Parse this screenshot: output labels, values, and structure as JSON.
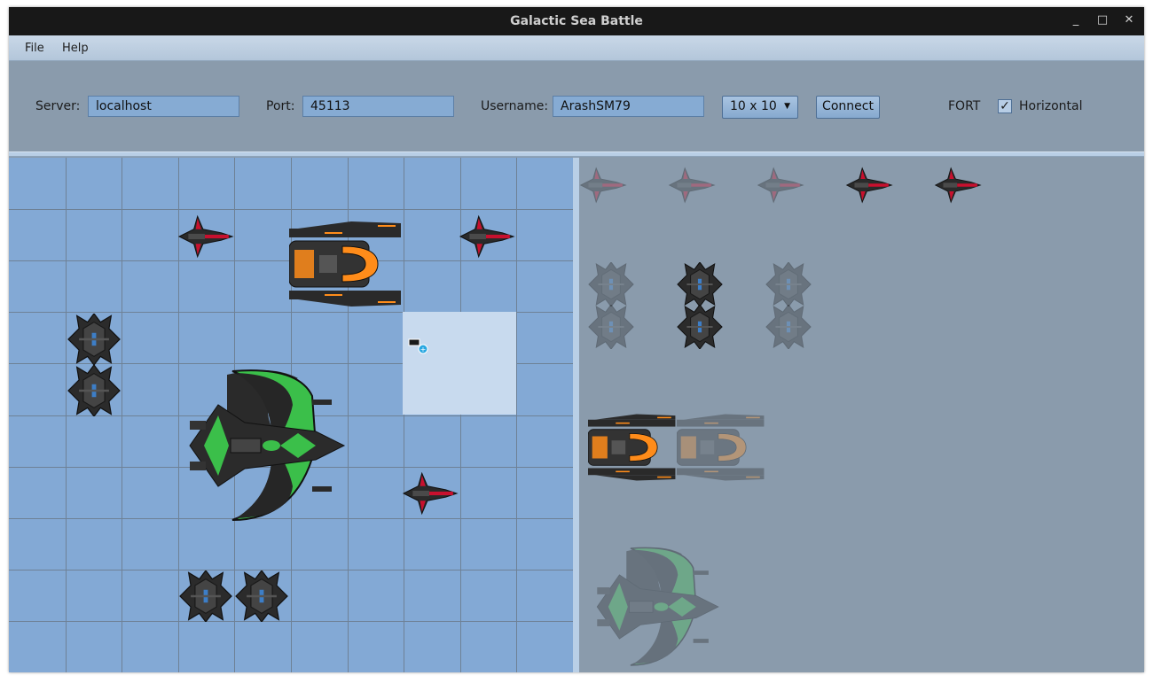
{
  "window": {
    "title": "Galactic Sea Battle",
    "minimize_glyph": "_",
    "maximize_glyph": "□",
    "close_glyph": "✕"
  },
  "menu": {
    "items": [
      {
        "label": "File"
      },
      {
        "label": "Help"
      }
    ]
  },
  "connection": {
    "server_label": "Server:",
    "server_value": "localhost",
    "port_label": "Port:",
    "port_value": "45113",
    "username_label": "Username:",
    "username_value": "ArashSM79",
    "board_size_value": "10 x 10",
    "connect_label": "Connect",
    "selected_ship_label": "FORT",
    "horizontal_label": "Horizontal",
    "horizontal_checked": true,
    "checkmark_glyph": "✓"
  },
  "board": {
    "rows": 10,
    "cols": 10
  },
  "colors": {
    "board_water": "#83a9d5",
    "grid_line": "#6e8196",
    "highlight": "#c8daee",
    "tray_bg": "#8a9bac",
    "accent_red": "#c8102e",
    "accent_orange": "#ff8c1a",
    "accent_green": "#3bbf4a",
    "accent_blue": "#3d7ec7"
  },
  "icons": {
    "fighter": "fighter-ship-icon",
    "fort": "fort-ship-icon",
    "cruiser": "cruiser-ship-icon",
    "carrier": "carrier-ship-icon",
    "drag_cursor": "drag-copy-cursor-icon"
  }
}
